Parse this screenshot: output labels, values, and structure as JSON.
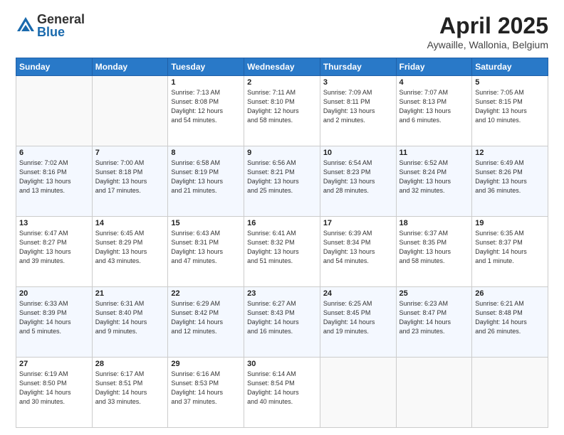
{
  "logo": {
    "general": "General",
    "blue": "Blue"
  },
  "title": "April 2025",
  "location": "Aywaille, Wallonia, Belgium",
  "days_of_week": [
    "Sunday",
    "Monday",
    "Tuesday",
    "Wednesday",
    "Thursday",
    "Friday",
    "Saturday"
  ],
  "weeks": [
    [
      {
        "day": "",
        "info": ""
      },
      {
        "day": "",
        "info": ""
      },
      {
        "day": "1",
        "info": "Sunrise: 7:13 AM\nSunset: 8:08 PM\nDaylight: 12 hours\nand 54 minutes."
      },
      {
        "day": "2",
        "info": "Sunrise: 7:11 AM\nSunset: 8:10 PM\nDaylight: 12 hours\nand 58 minutes."
      },
      {
        "day": "3",
        "info": "Sunrise: 7:09 AM\nSunset: 8:11 PM\nDaylight: 13 hours\nand 2 minutes."
      },
      {
        "day": "4",
        "info": "Sunrise: 7:07 AM\nSunset: 8:13 PM\nDaylight: 13 hours\nand 6 minutes."
      },
      {
        "day": "5",
        "info": "Sunrise: 7:05 AM\nSunset: 8:15 PM\nDaylight: 13 hours\nand 10 minutes."
      }
    ],
    [
      {
        "day": "6",
        "info": "Sunrise: 7:02 AM\nSunset: 8:16 PM\nDaylight: 13 hours\nand 13 minutes."
      },
      {
        "day": "7",
        "info": "Sunrise: 7:00 AM\nSunset: 8:18 PM\nDaylight: 13 hours\nand 17 minutes."
      },
      {
        "day": "8",
        "info": "Sunrise: 6:58 AM\nSunset: 8:19 PM\nDaylight: 13 hours\nand 21 minutes."
      },
      {
        "day": "9",
        "info": "Sunrise: 6:56 AM\nSunset: 8:21 PM\nDaylight: 13 hours\nand 25 minutes."
      },
      {
        "day": "10",
        "info": "Sunrise: 6:54 AM\nSunset: 8:23 PM\nDaylight: 13 hours\nand 28 minutes."
      },
      {
        "day": "11",
        "info": "Sunrise: 6:52 AM\nSunset: 8:24 PM\nDaylight: 13 hours\nand 32 minutes."
      },
      {
        "day": "12",
        "info": "Sunrise: 6:49 AM\nSunset: 8:26 PM\nDaylight: 13 hours\nand 36 minutes."
      }
    ],
    [
      {
        "day": "13",
        "info": "Sunrise: 6:47 AM\nSunset: 8:27 PM\nDaylight: 13 hours\nand 39 minutes."
      },
      {
        "day": "14",
        "info": "Sunrise: 6:45 AM\nSunset: 8:29 PM\nDaylight: 13 hours\nand 43 minutes."
      },
      {
        "day": "15",
        "info": "Sunrise: 6:43 AM\nSunset: 8:31 PM\nDaylight: 13 hours\nand 47 minutes."
      },
      {
        "day": "16",
        "info": "Sunrise: 6:41 AM\nSunset: 8:32 PM\nDaylight: 13 hours\nand 51 minutes."
      },
      {
        "day": "17",
        "info": "Sunrise: 6:39 AM\nSunset: 8:34 PM\nDaylight: 13 hours\nand 54 minutes."
      },
      {
        "day": "18",
        "info": "Sunrise: 6:37 AM\nSunset: 8:35 PM\nDaylight: 13 hours\nand 58 minutes."
      },
      {
        "day": "19",
        "info": "Sunrise: 6:35 AM\nSunset: 8:37 PM\nDaylight: 14 hours\nand 1 minute."
      }
    ],
    [
      {
        "day": "20",
        "info": "Sunrise: 6:33 AM\nSunset: 8:39 PM\nDaylight: 14 hours\nand 5 minutes."
      },
      {
        "day": "21",
        "info": "Sunrise: 6:31 AM\nSunset: 8:40 PM\nDaylight: 14 hours\nand 9 minutes."
      },
      {
        "day": "22",
        "info": "Sunrise: 6:29 AM\nSunset: 8:42 PM\nDaylight: 14 hours\nand 12 minutes."
      },
      {
        "day": "23",
        "info": "Sunrise: 6:27 AM\nSunset: 8:43 PM\nDaylight: 14 hours\nand 16 minutes."
      },
      {
        "day": "24",
        "info": "Sunrise: 6:25 AM\nSunset: 8:45 PM\nDaylight: 14 hours\nand 19 minutes."
      },
      {
        "day": "25",
        "info": "Sunrise: 6:23 AM\nSunset: 8:47 PM\nDaylight: 14 hours\nand 23 minutes."
      },
      {
        "day": "26",
        "info": "Sunrise: 6:21 AM\nSunset: 8:48 PM\nDaylight: 14 hours\nand 26 minutes."
      }
    ],
    [
      {
        "day": "27",
        "info": "Sunrise: 6:19 AM\nSunset: 8:50 PM\nDaylight: 14 hours\nand 30 minutes."
      },
      {
        "day": "28",
        "info": "Sunrise: 6:17 AM\nSunset: 8:51 PM\nDaylight: 14 hours\nand 33 minutes."
      },
      {
        "day": "29",
        "info": "Sunrise: 6:16 AM\nSunset: 8:53 PM\nDaylight: 14 hours\nand 37 minutes."
      },
      {
        "day": "30",
        "info": "Sunrise: 6:14 AM\nSunset: 8:54 PM\nDaylight: 14 hours\nand 40 minutes."
      },
      {
        "day": "",
        "info": ""
      },
      {
        "day": "",
        "info": ""
      },
      {
        "day": "",
        "info": ""
      }
    ]
  ]
}
